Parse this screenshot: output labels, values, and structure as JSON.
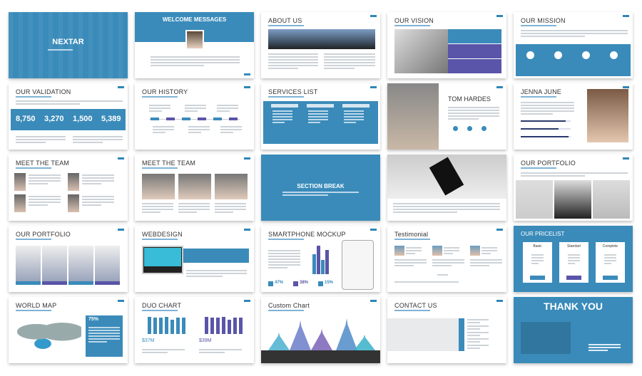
{
  "colors": {
    "primary": "#3a8bba",
    "accent": "#5a55a8",
    "dark": "#2b3a6b"
  },
  "slides": [
    {
      "variant": "cover",
      "title": "NEXTAR"
    },
    {
      "variant": "welcome",
      "title": "WELCOME MESSAGES"
    },
    {
      "variant": "about",
      "title": "ABOUT US"
    },
    {
      "variant": "vision",
      "title": "OUR VISION"
    },
    {
      "variant": "mission",
      "title": "OUR MISSION"
    },
    {
      "variant": "stats",
      "title": "OUR VALIDATION",
      "stats": [
        "8,750",
        "3,270",
        "1,500",
        "5,389"
      ]
    },
    {
      "variant": "history",
      "title": "OUR HISTORY"
    },
    {
      "variant": "services",
      "title": "SERVICES LIST"
    },
    {
      "variant": "person-left",
      "title": "TOM HARDES"
    },
    {
      "variant": "person-right",
      "title": "JENNA JUNE",
      "skills": [
        0.9,
        0.75,
        0.95
      ]
    },
    {
      "variant": "team4",
      "title": "MEET THE TEAM"
    },
    {
      "variant": "team3",
      "title": "MEET THE TEAM"
    },
    {
      "variant": "section",
      "title": "SECTION BREAK"
    },
    {
      "variant": "cards",
      "title": ""
    },
    {
      "variant": "portfolio2",
      "title": "OUR PORTFOLIO"
    },
    {
      "variant": "portfolio",
      "title": "OUR PORTFOLIO"
    },
    {
      "variant": "web",
      "title": "WEBDESIGN"
    },
    {
      "variant": "phone",
      "title": "SMARTPHONE MOCKUP",
      "stats": [
        "47%",
        "38%",
        "15%"
      ]
    },
    {
      "variant": "testimonial",
      "title": "Testimonial"
    },
    {
      "variant": "pricing",
      "title": "OUR PRICELIST",
      "plans": [
        "Basic",
        "Standart",
        "Complete"
      ]
    },
    {
      "variant": "map",
      "title": "WORLD MAP",
      "stats": [
        "75%"
      ]
    },
    {
      "variant": "duo",
      "title": "DUO CHART",
      "stats": [
        "$37M",
        "$39M"
      ]
    },
    {
      "variant": "custom",
      "title": "Custom Chart"
    },
    {
      "variant": "contact",
      "title": "CONTACT US"
    },
    {
      "variant": "thanks",
      "title": "THANK YOU"
    }
  ]
}
